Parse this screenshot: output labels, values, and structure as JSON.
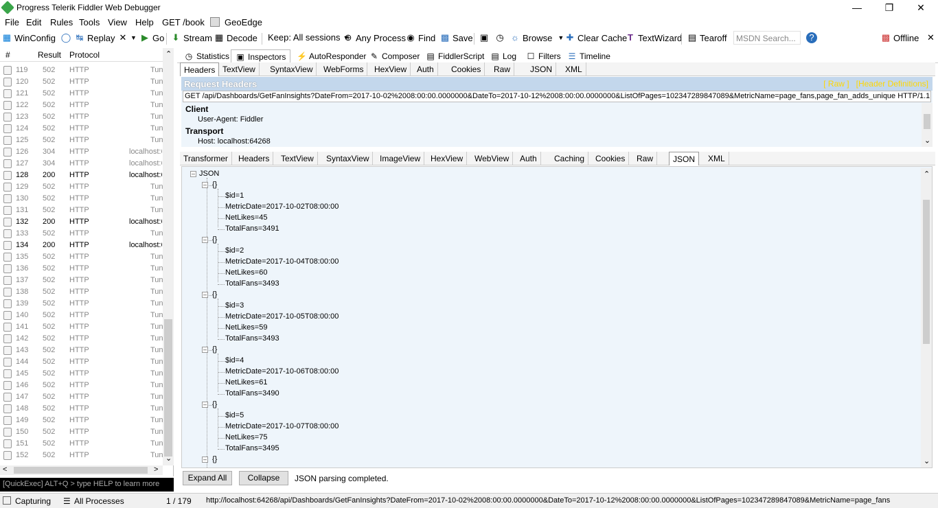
{
  "window": {
    "title": "Progress Telerik Fiddler Web Debugger"
  },
  "menu": [
    "File",
    "Edit",
    "Rules",
    "Tools",
    "View",
    "Help",
    "GET /book",
    "GeoEdge"
  ],
  "toolbar": {
    "winconfig": "WinConfig",
    "replay": "Replay",
    "go": "Go",
    "stream": "Stream",
    "decode": "Decode",
    "keep": "Keep: All sessions",
    "any_process": "Any Process",
    "find": "Find",
    "save": "Save",
    "browse": "Browse",
    "clear_cache": "Clear Cache",
    "textwizard": "TextWizard",
    "tearoff": "Tearoff",
    "msdn_placeholder": "MSDN Search...",
    "offline": "Offline"
  },
  "sessions": {
    "headers": {
      "num": "#",
      "result": "Result",
      "protocol": "Protocol"
    },
    "rows": [
      {
        "num": "119",
        "result": "502",
        "protocol": "HTTP",
        "host": "Tun",
        "dark": false
      },
      {
        "num": "120",
        "result": "502",
        "protocol": "HTTP",
        "host": "Tun",
        "dark": false
      },
      {
        "num": "121",
        "result": "502",
        "protocol": "HTTP",
        "host": "Tun",
        "dark": false
      },
      {
        "num": "122",
        "result": "502",
        "protocol": "HTTP",
        "host": "Tun",
        "dark": false
      },
      {
        "num": "123",
        "result": "502",
        "protocol": "HTTP",
        "host": "Tun",
        "dark": false
      },
      {
        "num": "124",
        "result": "502",
        "protocol": "HTTP",
        "host": "Tun",
        "dark": false
      },
      {
        "num": "125",
        "result": "502",
        "protocol": "HTTP",
        "host": "Tun",
        "dark": false
      },
      {
        "num": "126",
        "result": "304",
        "protocol": "HTTP",
        "host": "localhost:6",
        "dark": false
      },
      {
        "num": "127",
        "result": "304",
        "protocol": "HTTP",
        "host": "localhost:6",
        "dark": false
      },
      {
        "num": "128",
        "result": "200",
        "protocol": "HTTP",
        "host": "localhost:6",
        "dark": true
      },
      {
        "num": "129",
        "result": "502",
        "protocol": "HTTP",
        "host": "Tun",
        "dark": false
      },
      {
        "num": "130",
        "result": "502",
        "protocol": "HTTP",
        "host": "Tun",
        "dark": false
      },
      {
        "num": "131",
        "result": "502",
        "protocol": "HTTP",
        "host": "Tun",
        "dark": false
      },
      {
        "num": "132",
        "result": "200",
        "protocol": "HTTP",
        "host": "localhost:6",
        "dark": true
      },
      {
        "num": "133",
        "result": "502",
        "protocol": "HTTP",
        "host": "Tun",
        "dark": false
      },
      {
        "num": "134",
        "result": "200",
        "protocol": "HTTP",
        "host": "localhost:6",
        "dark": true
      },
      {
        "num": "135",
        "result": "502",
        "protocol": "HTTP",
        "host": "Tun",
        "dark": false
      },
      {
        "num": "136",
        "result": "502",
        "protocol": "HTTP",
        "host": "Tun",
        "dark": false
      },
      {
        "num": "137",
        "result": "502",
        "protocol": "HTTP",
        "host": "Tun",
        "dark": false
      },
      {
        "num": "138",
        "result": "502",
        "protocol": "HTTP",
        "host": "Tun",
        "dark": false
      },
      {
        "num": "139",
        "result": "502",
        "protocol": "HTTP",
        "host": "Tun",
        "dark": false
      },
      {
        "num": "140",
        "result": "502",
        "protocol": "HTTP",
        "host": "Tun",
        "dark": false
      },
      {
        "num": "141",
        "result": "502",
        "protocol": "HTTP",
        "host": "Tun",
        "dark": false
      },
      {
        "num": "142",
        "result": "502",
        "protocol": "HTTP",
        "host": "Tun",
        "dark": false
      },
      {
        "num": "143",
        "result": "502",
        "protocol": "HTTP",
        "host": "Tun",
        "dark": false
      },
      {
        "num": "144",
        "result": "502",
        "protocol": "HTTP",
        "host": "Tun",
        "dark": false
      },
      {
        "num": "145",
        "result": "502",
        "protocol": "HTTP",
        "host": "Tun",
        "dark": false
      },
      {
        "num": "146",
        "result": "502",
        "protocol": "HTTP",
        "host": "Tun",
        "dark": false
      },
      {
        "num": "147",
        "result": "502",
        "protocol": "HTTP",
        "host": "Tun",
        "dark": false
      },
      {
        "num": "148",
        "result": "502",
        "protocol": "HTTP",
        "host": "Tun",
        "dark": false
      },
      {
        "num": "149",
        "result": "502",
        "protocol": "HTTP",
        "host": "Tun",
        "dark": false
      },
      {
        "num": "150",
        "result": "502",
        "protocol": "HTTP",
        "host": "Tun",
        "dark": false
      },
      {
        "num": "151",
        "result": "502",
        "protocol": "HTTP",
        "host": "Tun",
        "dark": false
      },
      {
        "num": "152",
        "result": "502",
        "protocol": "HTTP",
        "host": "Tun",
        "dark": false
      }
    ]
  },
  "quickexec": "[QuickExec] ALT+Q > type HELP to learn more",
  "inspector_tabs": [
    "Statistics",
    "Inspectors",
    "AutoResponder",
    "Composer",
    "FiddlerScript",
    "Log",
    "Filters",
    "Timeline"
  ],
  "request_tabs": [
    "Headers",
    "TextView",
    "SyntaxView",
    "WebForms",
    "HexView",
    "Auth",
    "Cookies",
    "Raw",
    "JSON",
    "XML"
  ],
  "request": {
    "title": "Request Headers",
    "raw_link": "[ Raw ]",
    "defs_link": "[Header Definitions]",
    "line": "GET /api/Dashboards/GetFanInsights?DateFrom=2017-10-02%2008:00:00.0000000&DateTo=2017-10-12%2008:00:00.0000000&ListOfPages=102347289847089&MetricName=page_fans,page_fan_adds_unique HTTP/1.1",
    "client_label": "Client",
    "user_agent": "User-Agent: Fiddler",
    "transport_label": "Transport",
    "host": "Host: localhost:64268"
  },
  "response_tabs": [
    "Transformer",
    "Headers",
    "TextView",
    "SyntaxView",
    "ImageView",
    "HexView",
    "WebView",
    "Auth",
    "Caching",
    "Cookies",
    "Raw",
    "JSON",
    "XML"
  ],
  "json_tree": {
    "root": "JSON",
    "objects": [
      {
        "id": "$id=1",
        "date": "MetricDate=2017-10-02T08:00:00",
        "likes": "NetLikes=45",
        "fans": "TotalFans=3491"
      },
      {
        "id": "$id=2",
        "date": "MetricDate=2017-10-04T08:00:00",
        "likes": "NetLikes=60",
        "fans": "TotalFans=3493"
      },
      {
        "id": "$id=3",
        "date": "MetricDate=2017-10-05T08:00:00",
        "likes": "NetLikes=59",
        "fans": "TotalFans=3493"
      },
      {
        "id": "$id=4",
        "date": "MetricDate=2017-10-06T08:00:00",
        "likes": "NetLikes=61",
        "fans": "TotalFans=3490"
      },
      {
        "id": "$id=5",
        "date": "MetricDate=2017-10-07T08:00:00",
        "likes": "NetLikes=75",
        "fans": "TotalFans=3495"
      }
    ]
  },
  "json_actions": {
    "expand": "Expand All",
    "collapse": "Collapse",
    "status": "JSON parsing completed."
  },
  "status": {
    "capturing": "Capturing",
    "processes": "All Processes",
    "count": "1 / 179",
    "url": "http://localhost:64268/api/Dashboards/GetFanInsights?DateFrom=2017-10-02%2008:00:00.0000000&DateTo=2017-10-12%2008:00:00.0000000&ListOfPages=102347289847089&MetricName=page_fans"
  }
}
